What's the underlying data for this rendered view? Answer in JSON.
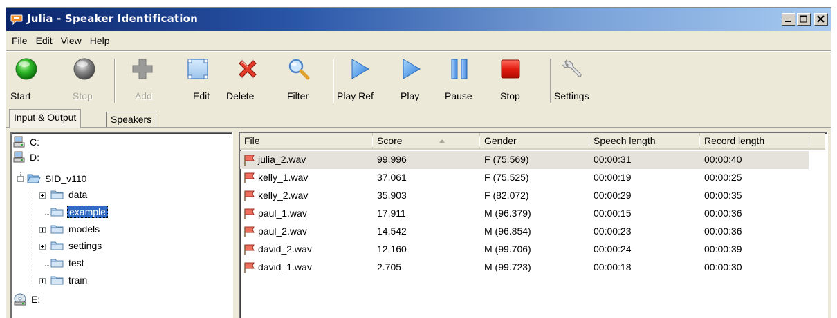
{
  "window": {
    "title": "Julia - Speaker Identification",
    "controls": [
      "minimize",
      "maximize",
      "close"
    ]
  },
  "menu": [
    "File",
    "Edit",
    "View",
    "Help"
  ],
  "toolbar": [
    {
      "label": "Start",
      "icon": "green-circle-icon",
      "enabled": true
    },
    {
      "label": "Stop",
      "icon": "gray-circle-icon",
      "enabled": false
    },
    {
      "label": "Add",
      "icon": "plus-icon",
      "enabled": false
    },
    {
      "label": "Edit",
      "icon": "edit-frame-icon",
      "enabled": true
    },
    {
      "label": "Delete",
      "icon": "red-x-icon",
      "enabled": true
    },
    {
      "label": "Filter",
      "icon": "magnifier-icon",
      "enabled": true
    },
    {
      "label": "Play Ref",
      "icon": "play-icon",
      "enabled": true
    },
    {
      "label": "Play",
      "icon": "play-icon",
      "enabled": true
    },
    {
      "label": "Pause",
      "icon": "pause-icon",
      "enabled": true
    },
    {
      "label": "Stop",
      "icon": "red-square-icon",
      "enabled": true
    },
    {
      "label": "Settings",
      "icon": "wrench-icon",
      "enabled": true
    }
  ],
  "tabs": [
    {
      "label": "Input & Output",
      "active": true
    },
    {
      "label": "Speakers",
      "active": false
    }
  ],
  "tree": [
    {
      "label": "C:",
      "type": "drive"
    },
    {
      "label": "D:",
      "type": "drive"
    },
    {
      "label": "SID_v110",
      "type": "folder-open",
      "expanded": true
    },
    {
      "label": "data",
      "type": "folder",
      "expandable": true
    },
    {
      "label": "example",
      "type": "folder",
      "selected": true
    },
    {
      "label": "models",
      "type": "folder",
      "expandable": true
    },
    {
      "label": "settings",
      "type": "folder",
      "expandable": true
    },
    {
      "label": "test",
      "type": "folder"
    },
    {
      "label": "train",
      "type": "folder",
      "expandable": true
    },
    {
      "label": "E:",
      "type": "cdrom"
    }
  ],
  "list": {
    "columns": [
      "File",
      "Score",
      "Gender",
      "Speech length",
      "Record length"
    ],
    "sorted_column": "Score",
    "rows": [
      {
        "file": "julia_2.wav",
        "score": "99.996",
        "gender": "F (75.569)",
        "speech": "00:00:31",
        "record": "00:00:40",
        "highlight": true
      },
      {
        "file": "kelly_1.wav",
        "score": "37.061",
        "gender": "F (75.525)",
        "speech": "00:00:19",
        "record": "00:00:25"
      },
      {
        "file": "kelly_2.wav",
        "score": "35.903",
        "gender": "F (82.072)",
        "speech": "00:00:29",
        "record": "00:00:35"
      },
      {
        "file": "paul_1.wav",
        "score": "17.911",
        "gender": "M (96.379)",
        "speech": "00:00:15",
        "record": "00:00:36"
      },
      {
        "file": "paul_2.wav",
        "score": "14.542",
        "gender": "M (96.854)",
        "speech": "00:00:23",
        "record": "00:00:36"
      },
      {
        "file": "david_2.wav",
        "score": "12.160",
        "gender": "M (99.706)",
        "speech": "00:00:24",
        "record": "00:00:39"
      },
      {
        "file": "david_1.wav",
        "score": "2.705",
        "gender": "M (99.723)",
        "speech": "00:00:18",
        "record": "00:00:30"
      }
    ]
  }
}
